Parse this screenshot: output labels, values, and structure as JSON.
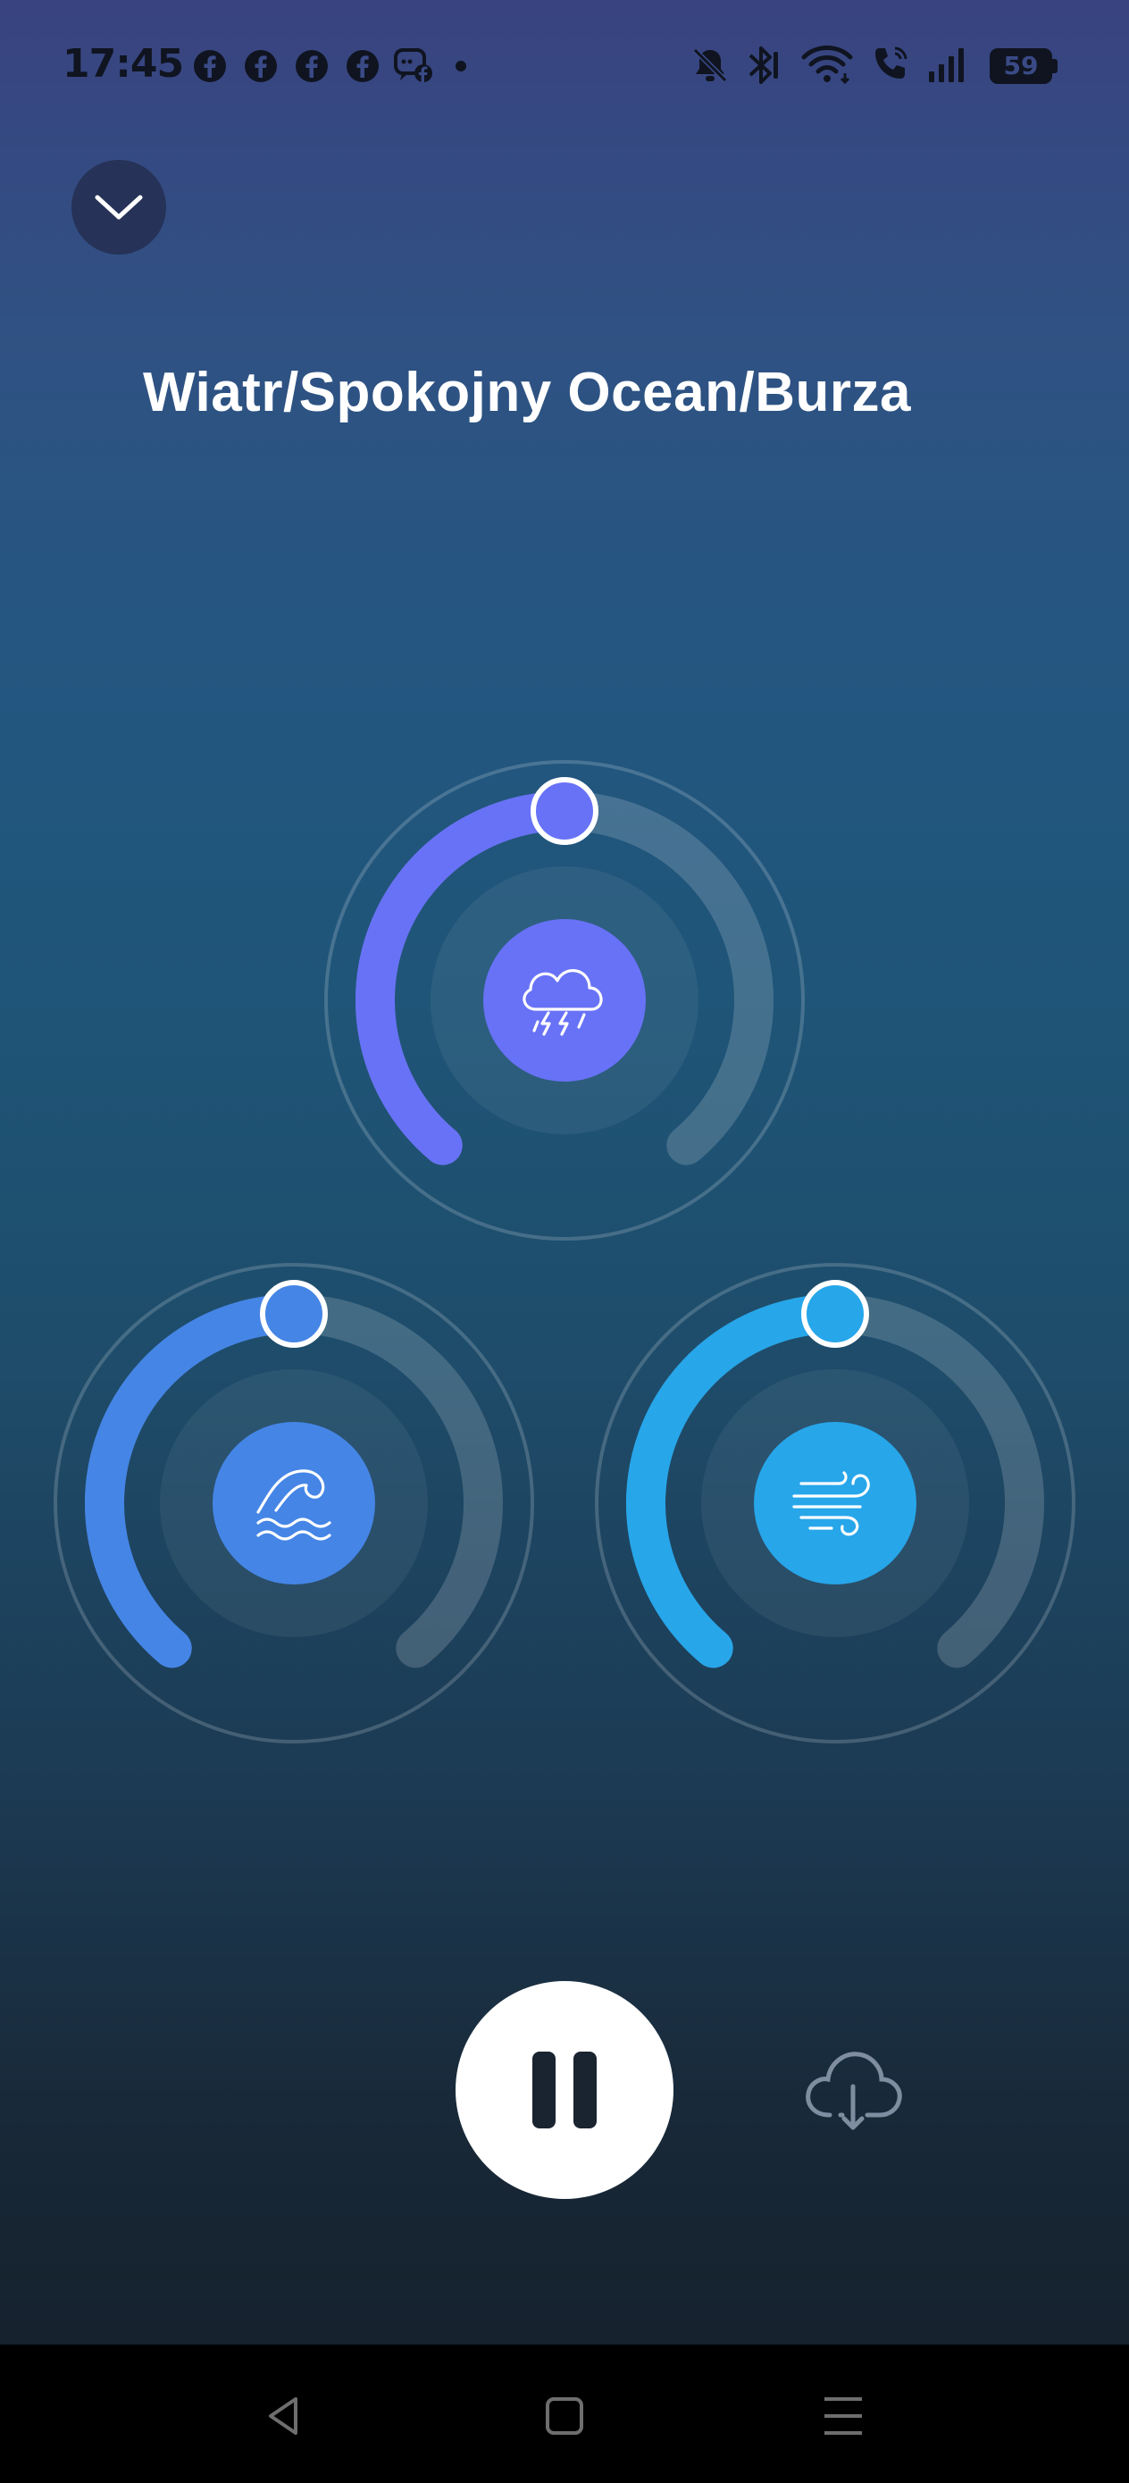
{
  "status_bar": {
    "time": "17:45",
    "battery_level": "59",
    "notification_icons": [
      "facebook-icon",
      "facebook-icon",
      "facebook-icon",
      "facebook-icon",
      "messenger-chat-icon",
      "more-notifications-dot"
    ],
    "system_icons": [
      "bell-muted-icon",
      "bluetooth-icon",
      "wifi-icon",
      "wifi-calling-icon",
      "signal-icon",
      "battery-icon"
    ]
  },
  "header": {
    "collapse_icon": "chevron-down-icon",
    "title": "Wiatr/Spokojny Ocean/Burza"
  },
  "mixer": {
    "channels": [
      {
        "id": "storm",
        "icon": "thunderstorm-icon",
        "volume": 0.5,
        "color": "#6872f6"
      },
      {
        "id": "ocean",
        "icon": "wave-icon",
        "volume": 0.5,
        "color": "#4585e6"
      },
      {
        "id": "wind",
        "icon": "wind-icon",
        "volume": 0.5,
        "color": "#27a6ea"
      }
    ]
  },
  "controls": {
    "state": "playing",
    "pause_icon": "pause-icon",
    "download_icon": "cloud-download-icon"
  },
  "nav_bar": {
    "buttons": [
      "back-icon",
      "home-icon",
      "recent-apps-icon"
    ]
  }
}
